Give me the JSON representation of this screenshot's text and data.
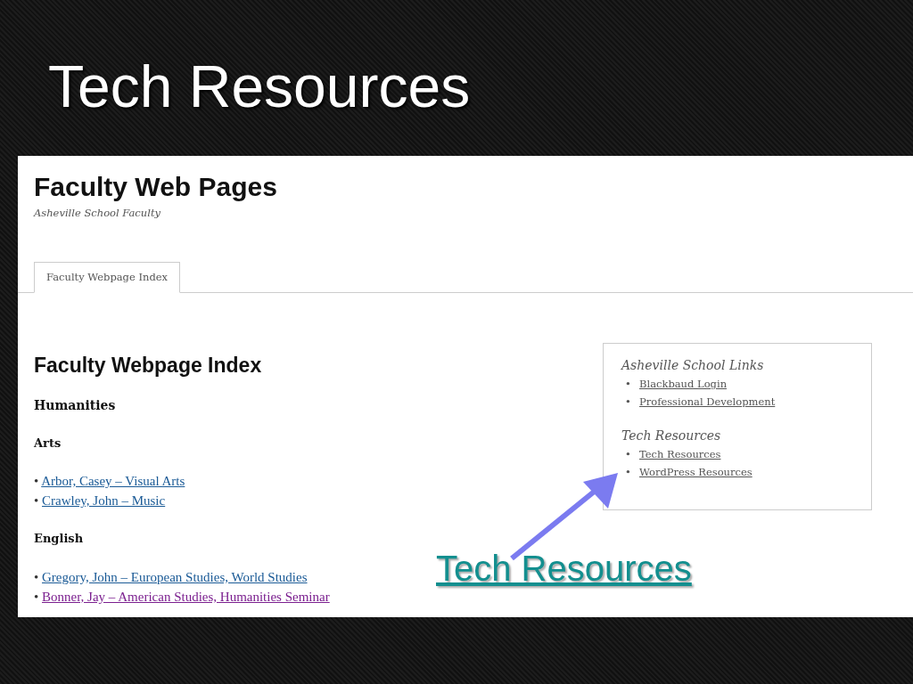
{
  "slide_title": "Tech Resources",
  "site": {
    "title": "Faculty Web Pages",
    "tagline": "Asheville School Faculty"
  },
  "tabs": [
    {
      "label": "Faculty Webpage Index",
      "selected": true
    }
  ],
  "content": {
    "heading": "Faculty Webpage Index",
    "sections": [
      {
        "kind": "department",
        "text": "Humanities"
      },
      {
        "kind": "subject",
        "text": "Arts"
      },
      {
        "kind": "link",
        "bullet": "•",
        "text": "Arbor, Casey – Visual Arts",
        "visited": false
      },
      {
        "kind": "link",
        "bullet": "•",
        "text": "Crawley, John – Music",
        "visited": false
      },
      {
        "kind": "subject",
        "text": "English"
      },
      {
        "kind": "link",
        "bullet": "•",
        "text": "Gregory, John – European Studies, World Studies",
        "visited": false
      },
      {
        "kind": "link",
        "bullet": "•",
        "text": "Bonner, Jay – American Studies, Humanities Seminar",
        "visited": true
      }
    ]
  },
  "sidebar": {
    "widgets": [
      {
        "title": "Asheville School Links",
        "links": [
          {
            "bullet": "•",
            "text": "Blackbaud Login"
          },
          {
            "bullet": "•",
            "text": "Professional Development"
          }
        ]
      },
      {
        "title": "Tech Resources",
        "links": [
          {
            "bullet": "•",
            "text": "Tech Resources"
          },
          {
            "bullet": "•",
            "text": "WordPress Resources"
          }
        ]
      }
    ]
  },
  "callout": {
    "text": "Tech Resources"
  }
}
